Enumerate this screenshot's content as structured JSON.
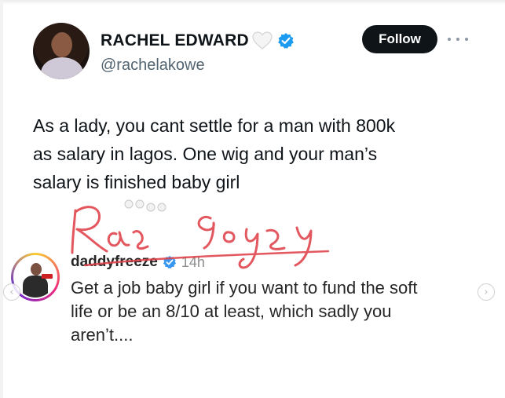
{
  "tweet": {
    "display_name": "RACHEL EDWARD",
    "handle": "@rachelakowe",
    "follow_label": "Follow",
    "text_lines": [
      "As a lady, you cant settle for a man with 800k",
      "as salary in lagos. One wig and your man’s",
      "salary is finished baby girl"
    ]
  },
  "reply": {
    "username": "daddyfreeze",
    "time": "14h",
    "text_lines": [
      "Get a job baby girl if you want to fund the soft",
      "life or be an 8/10 at least, which sadly you",
      "aren’t...."
    ]
  },
  "carousel": {
    "prev_glyph": "‹",
    "next_glyph": "›"
  },
  "colors": {
    "follow_bg": "#0f1419",
    "verified_blue": "#1d9bf0",
    "handle_gray": "#536471",
    "watermark_red": "#e0404a"
  },
  "icons": {
    "heart": "white-heart-icon",
    "verified": "verified-badge-icon",
    "more": "more-options-icon"
  }
}
